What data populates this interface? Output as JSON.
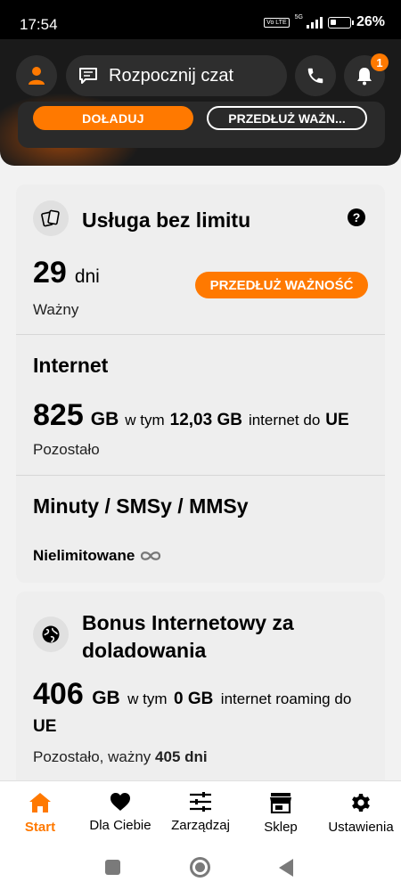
{
  "status_bar": {
    "time": "17:54",
    "volte": "Vo LTE",
    "network": "5G",
    "battery": "26%"
  },
  "header": {
    "chat_label": "Rozpocznij czat",
    "notification_count": "1",
    "topup_label": "DOŁADUJ",
    "extend_label": "PRZEDŁUŻ WAŻN..."
  },
  "unlimited_card": {
    "title": "Usługa bez limitu",
    "days_value": "29",
    "days_unit": "dni",
    "validity_label": "Ważny",
    "extend_button": "PRZEDŁUŻ WAŻNOŚĆ",
    "internet": {
      "title": "Internet",
      "value": "825",
      "unit": "GB",
      "mid_text": "w tym",
      "eu_value": "12,03 GB",
      "eu_text": "internet do",
      "eu_label": "UE",
      "remaining_label": "Pozostało"
    },
    "calls": {
      "title": "Minuty / SMSy / MMSy",
      "status": "Nielimitowane"
    }
  },
  "bonus_card": {
    "title_line1": "Bonus Internetowy za",
    "title_line2": "doladowania",
    "value": "406",
    "unit": "GB",
    "mid_text": "w tym",
    "roaming_value": "0 GB",
    "roaming_text": "internet roaming do",
    "roaming_label": "UE",
    "remaining_text": "Pozostało, ważny",
    "valid_days": "405 dni"
  },
  "bottom_nav": {
    "items": [
      {
        "label": "Start",
        "icon": "home-icon",
        "active": true
      },
      {
        "label": "Dla Ciebie",
        "icon": "heart-icon",
        "active": false
      },
      {
        "label": "Zarządzaj",
        "icon": "sliders-icon",
        "active": false
      },
      {
        "label": "Sklep",
        "icon": "shop-icon",
        "active": false
      },
      {
        "label": "Ustawienia",
        "icon": "gear-icon",
        "active": false
      }
    ]
  },
  "colors": {
    "accent": "#ff7900",
    "header_bg": "#1a1a1a",
    "page_bg": "#f2f2f2"
  }
}
